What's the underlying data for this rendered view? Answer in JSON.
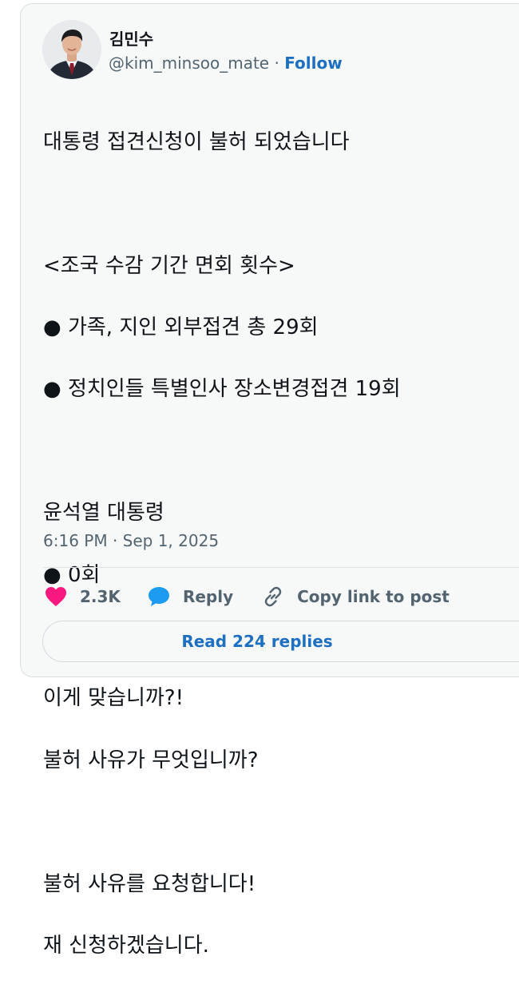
{
  "author": {
    "display_name": "김민수",
    "handle": "@kim_minsoo_mate",
    "separator": " · ",
    "follow_label": "Follow"
  },
  "post": {
    "lines": [
      "대통령 접견신청이 불허 되었습니다",
      "",
      "<조국 수감 기간 면회 횟수>",
      "● 가족, 지인 외부접견 총 29회",
      "● 정치인들 특별인사 장소변경접견 19회",
      "",
      "윤석열 대통령",
      "● 0회",
      "",
      "이게 맞습니까?!",
      "불허 사유가 무엇입니까?",
      "",
      "불허 사유를 요청합니다!",
      "재 신청하겠습니다."
    ],
    "timestamp": "6:16 PM · Sep 1, 2025"
  },
  "actions": {
    "like_count": "2.3K",
    "reply_label": "Reply",
    "copy_label": "Copy link to post",
    "read_replies_label": "Read 224 replies"
  },
  "colors": {
    "like": "#f91880",
    "reply": "#1d9bf0",
    "link": "#1d6fc2",
    "muted": "#536471"
  },
  "icons": {
    "like": "heart-icon",
    "reply": "speech-bubble-icon",
    "copy": "link-icon"
  }
}
